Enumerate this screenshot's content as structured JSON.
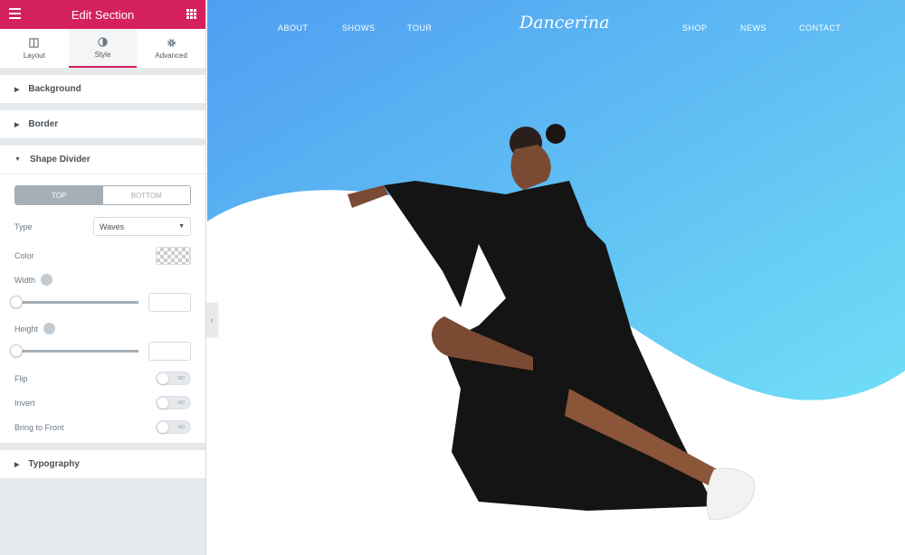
{
  "panel": {
    "title": "Edit Section",
    "tabs": [
      {
        "label": "Layout",
        "icon": "layout-icon"
      },
      {
        "label": "Style",
        "icon": "half-circle-icon"
      },
      {
        "label": "Advanced",
        "icon": "gear-icon"
      }
    ],
    "sections": {
      "background": "Background",
      "border": "Border",
      "shape_divider": "Shape Divider",
      "typography": "Typography"
    },
    "shape_divider": {
      "top": "TOP",
      "bottom": "BOTTOM",
      "type_label": "Type",
      "type_value": "Waves",
      "color_label": "Color",
      "width_label": "Width",
      "height_label": "Height",
      "flip_label": "Flip",
      "invert_label": "Invert",
      "front_label": "Bring to Front",
      "toggle_off": "NO"
    }
  },
  "site": {
    "nav_left": [
      "ABOUT",
      "SHOWS",
      "TOUR"
    ],
    "logo": "Dancerina",
    "nav_right": [
      "SHOP",
      "NEWS",
      "CONTACT"
    ]
  },
  "colors": {
    "accent": "#d5205f",
    "gradient_start": "#4f9ef1",
    "gradient_end": "#70def6"
  }
}
